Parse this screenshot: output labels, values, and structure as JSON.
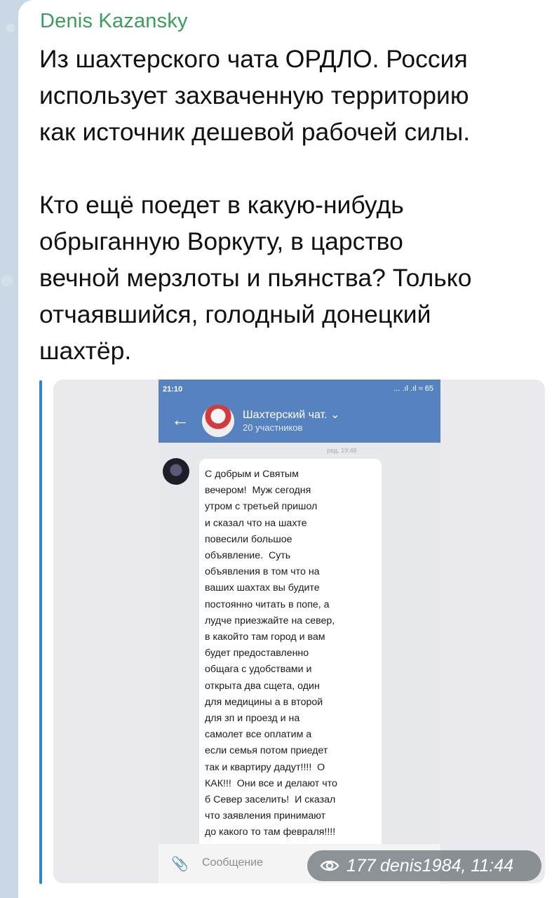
{
  "post": {
    "author": "Denis Kazansky",
    "text": "Из шахтерского чата ОРДЛО. Россия\nиспользует захваченную территорию\nкак источник дешевой рабочей силы.\n\nКто ещё поедет в какую-нибудь\nобрыганную Воркуту, в царство\nвечной мерзлоты и пьянства? Только\nотчаявшийся, голодный донецкий\nшахтёр.",
    "views": "177",
    "signature_time": "denis1984, 11:44"
  },
  "screenshot": {
    "status_time": "21:10",
    "status_icons": "... .ıl .ıl ≈ 65",
    "chat_title": "Шахтерский чат. ⌄",
    "chat_subtitle": "20 участников",
    "faint_text": "ред. 19:48",
    "message": "С добрым и Святым\nвечером!  Муж сегодня\nутром с третьей пришол\nи сказал что на шахте\nповесили большое\nобъявление.  Суть\nобъявления в том что на\nваших шахтах вы будите\nпостоянно читать в попе, а\nлудче приезжайте на север,\nв какойто там город и вам\nбудет предоставленно\nобщага с удобствами и\nоткрыта два сщета, один\nдля медицины а в второй\nдля зп и проезд и на\nсамолет все оплатим а\nесли семья потом приедет\nтак и квартиру дадут!!!!  О\nКАК!!!  Они все и делают что\nб Север заселить!  И сказал\nчто заявления принимают\nдо какого то там февраля!!!!",
    "input_placeholder": "Сообщение"
  },
  "colors": {
    "author": "#3a9d5c",
    "quote_bar": "#2b87d6",
    "chat_header": "#5682c0"
  }
}
